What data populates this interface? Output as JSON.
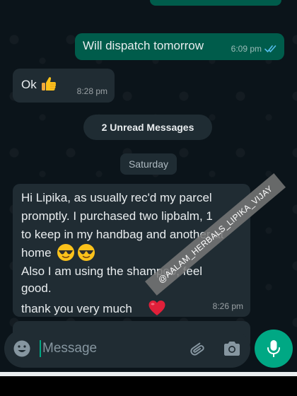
{
  "conversation": {
    "outgoing_message": {
      "text": "Will dispatch tomorrow",
      "time": "6:09 pm",
      "status_icon": "double-check-icon"
    },
    "reply_ok": {
      "text": "Ok",
      "emoji_icon": "thumbs-up-icon",
      "time": "8:28 pm"
    },
    "unread_banner": "2 Unread Messages",
    "date_separator": "Saturday",
    "incoming_message": {
      "lines": [
        "Hi Lipika, as usually rec'd my parcel",
        "promptly. I purchased two lipbalm, 1",
        "to keep in my handbag and another at",
        "home",
        "Also I am using the shampoo, feel",
        "good.",
        " thank you very much"
      ],
      "emoji_icons": [
        "sunglasses-face-icon",
        "sunglasses-face-icon",
        "red-heart-icon"
      ],
      "time": "8:26 pm"
    }
  },
  "watermark": "@AALAM_HERBALS_LIPIKA_VIJAY",
  "composer": {
    "placeholder": "Message",
    "value": ""
  },
  "colors": {
    "background": "#0b141a",
    "outgoing_bubble": "#005c4b",
    "incoming_bubble": "#202c33",
    "accent": "#00a884",
    "read_tick": "#53bdeb"
  }
}
